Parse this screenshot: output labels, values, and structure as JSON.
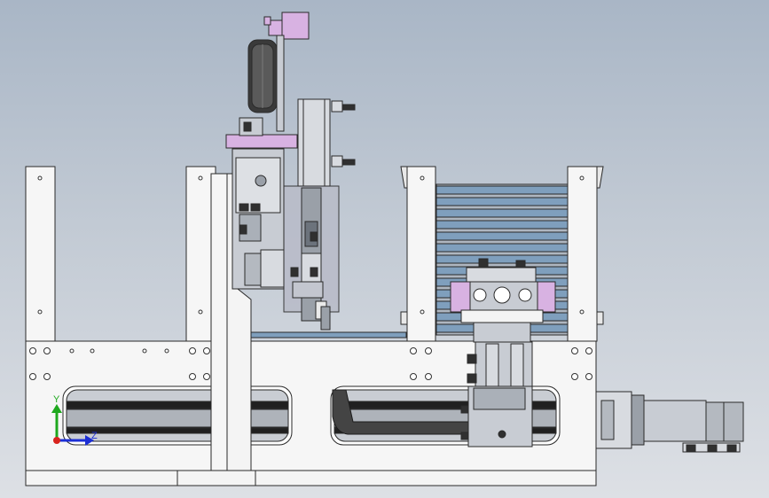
{
  "app": {
    "view": "cad-3d-viewport",
    "background_top": "#a9b6c6",
    "background_bottom": "#dde0e5"
  },
  "triad": {
    "y_label": "Y",
    "z_label": "Z",
    "y_color": "#1ea81e",
    "z_color": "#1c2fd6",
    "x_color": "#d8231d"
  },
  "colors": {
    "frame_white": "#f4f4f4",
    "outline": "#2a2a2a",
    "accent_purple": "#d8b2e2",
    "slot_black": "#202020",
    "steel_gray": "#9aa0a8",
    "blue_bars": "#7f9fbd"
  }
}
